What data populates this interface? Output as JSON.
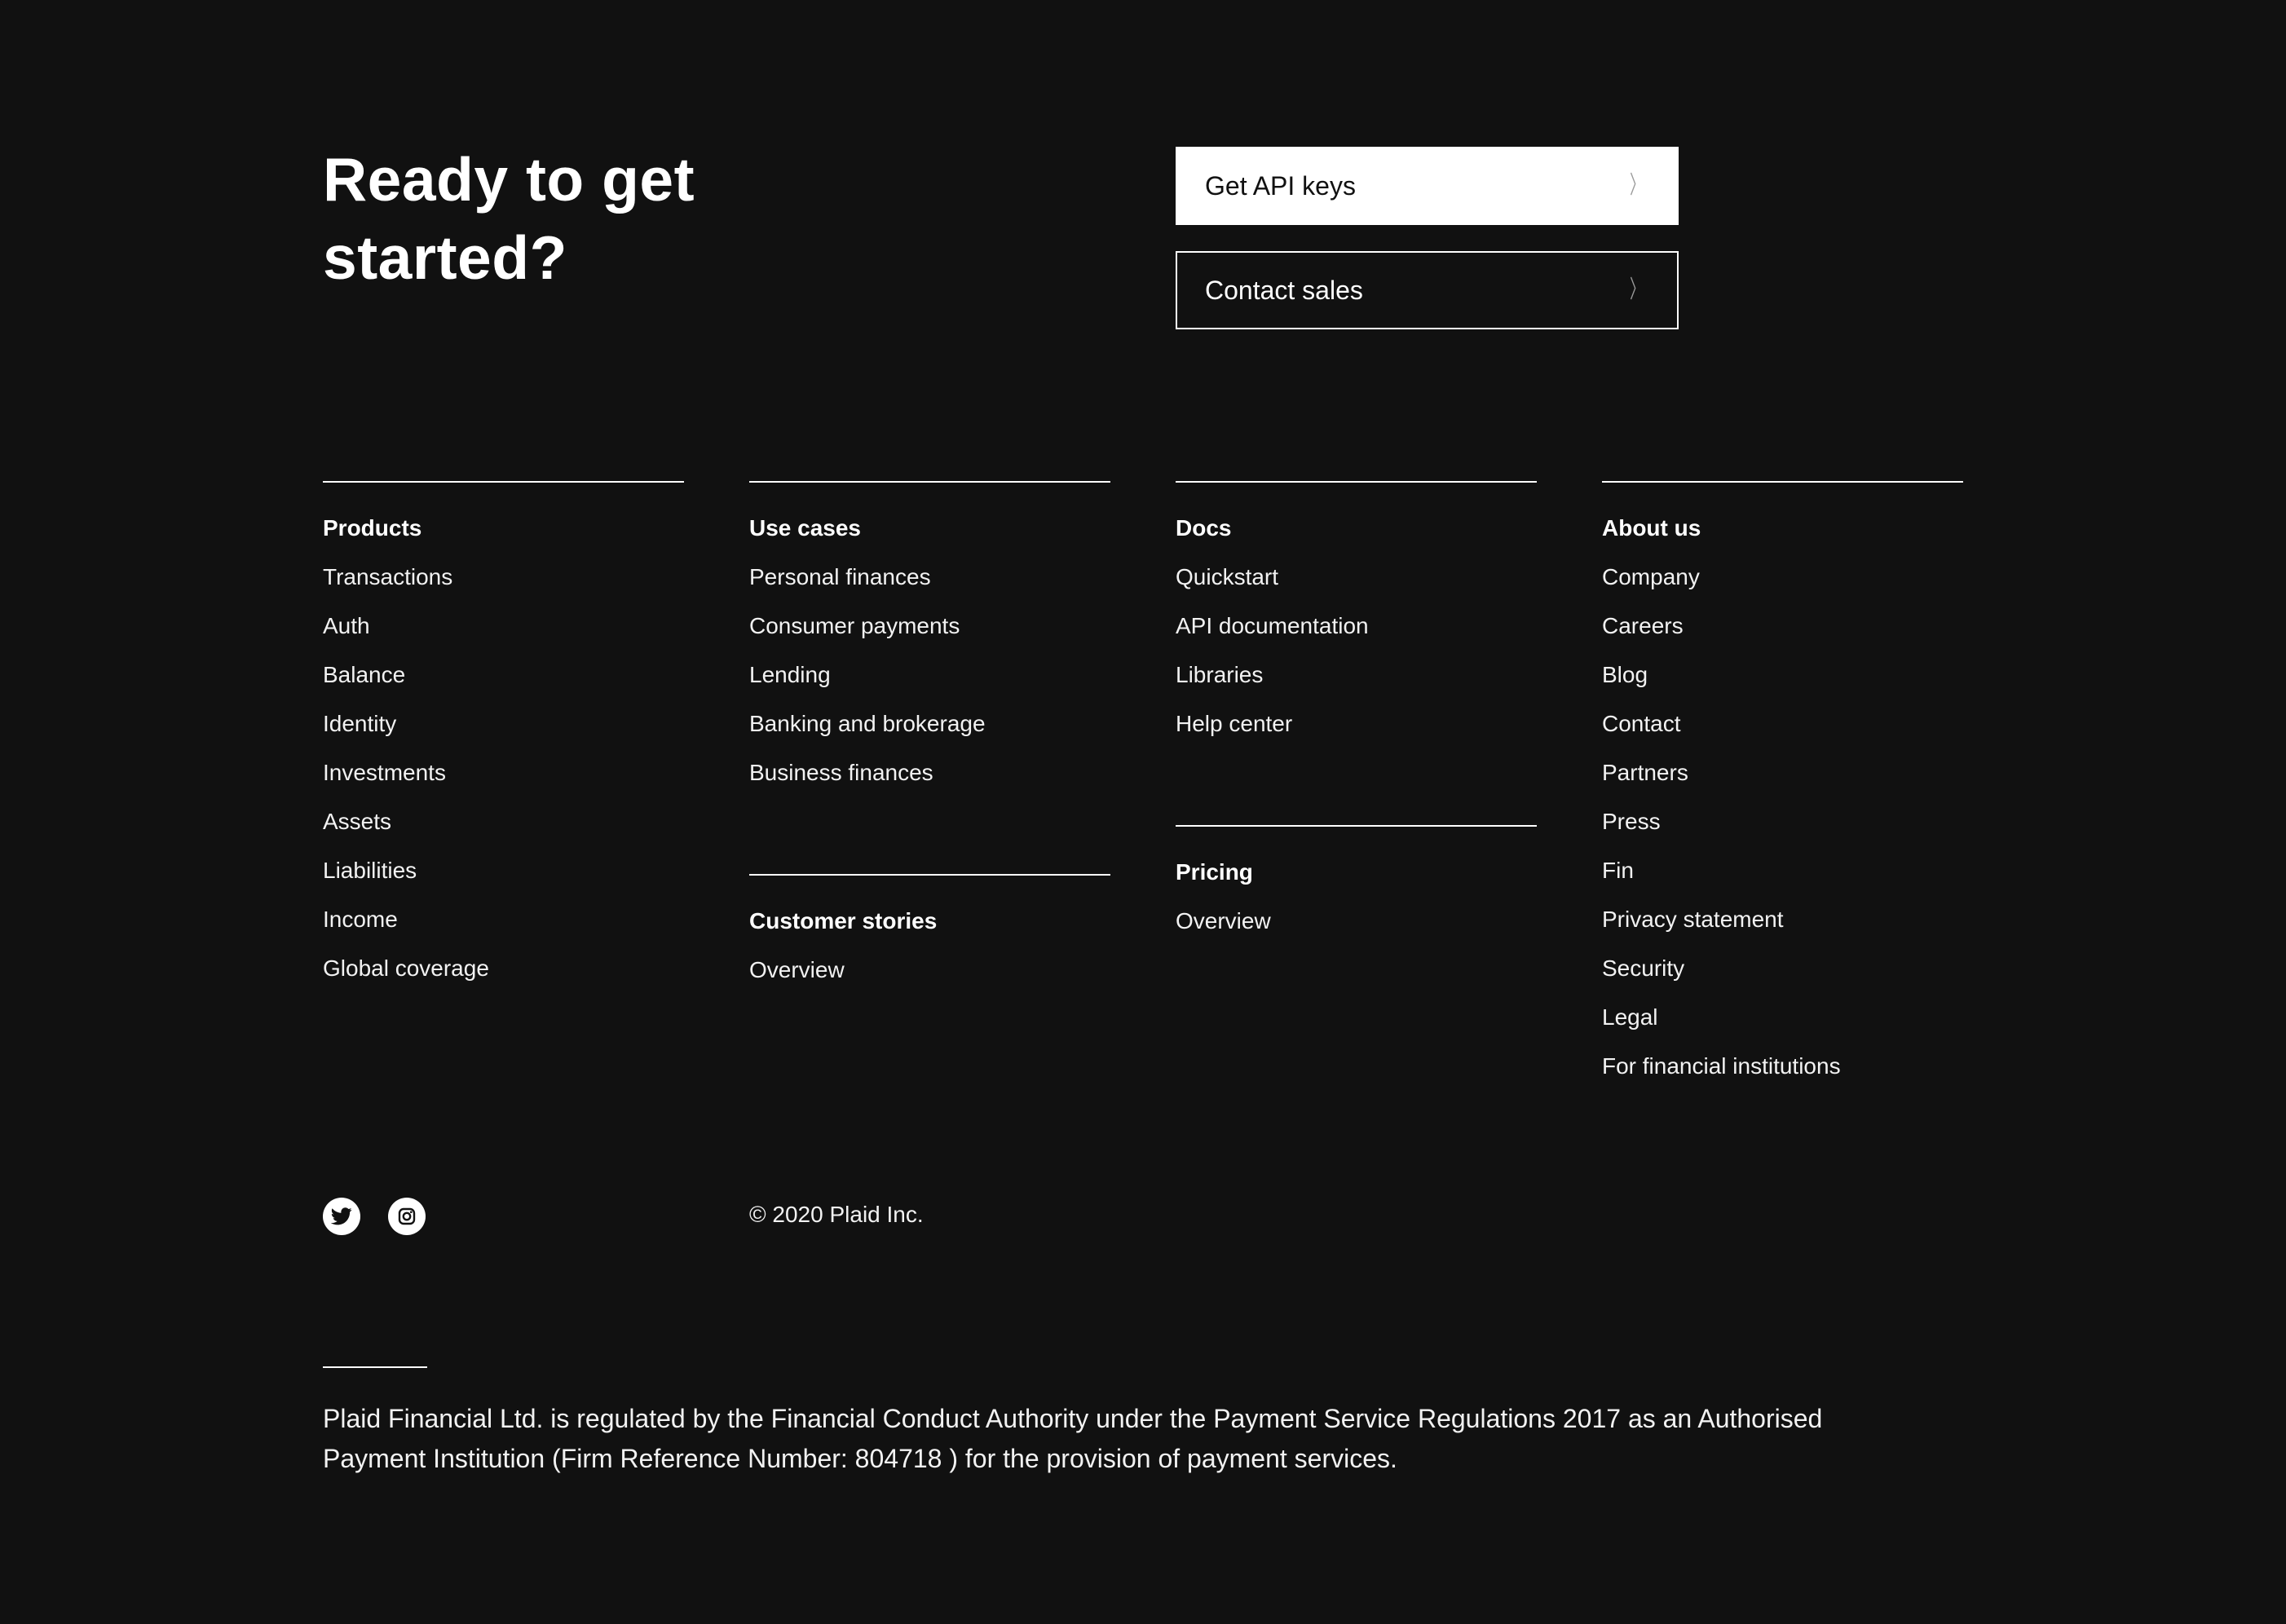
{
  "hero": {
    "headline": "Ready to get started?"
  },
  "cta": {
    "primary_label": "Get API keys",
    "secondary_label": "Contact sales",
    "chevron": "〉"
  },
  "columns": {
    "products": {
      "title": "Products",
      "items": [
        "Transactions",
        "Auth",
        "Balance",
        "Identity",
        "Investments",
        "Assets",
        "Liabilities",
        "Income",
        "Global coverage"
      ]
    },
    "use_cases": {
      "title": "Use cases",
      "items": [
        "Personal finances",
        "Consumer payments",
        "Lending",
        "Banking and brokerage",
        "Business finances"
      ]
    },
    "customer_stories": {
      "title": "Customer stories",
      "items": [
        "Overview"
      ]
    },
    "docs": {
      "title": "Docs",
      "items": [
        "Quickstart",
        "API documentation",
        "Libraries",
        "Help center"
      ]
    },
    "pricing": {
      "title": "Pricing",
      "items": [
        "Overview"
      ]
    },
    "about_us": {
      "title": "About us",
      "items": [
        "Company",
        "Careers",
        "Blog",
        "Contact",
        "Partners",
        "Press",
        "Fin",
        "Privacy statement",
        "Security",
        "Legal",
        "For financial institutions"
      ]
    }
  },
  "social": {
    "icons": [
      "twitter-icon",
      "instagram-icon"
    ]
  },
  "footer": {
    "copyright": "© 2020 Plaid Inc.",
    "legal": "Plaid Financial Ltd. is regulated by the Financial Conduct Authority under the Payment Service Regulations 2017 as an Authorised Payment Institution (Firm Reference Number: 804718 ) for the provision of payment services."
  },
  "colors": {
    "background": "#111111",
    "text": "#ffffff",
    "chevron": "#9a9a9a"
  }
}
